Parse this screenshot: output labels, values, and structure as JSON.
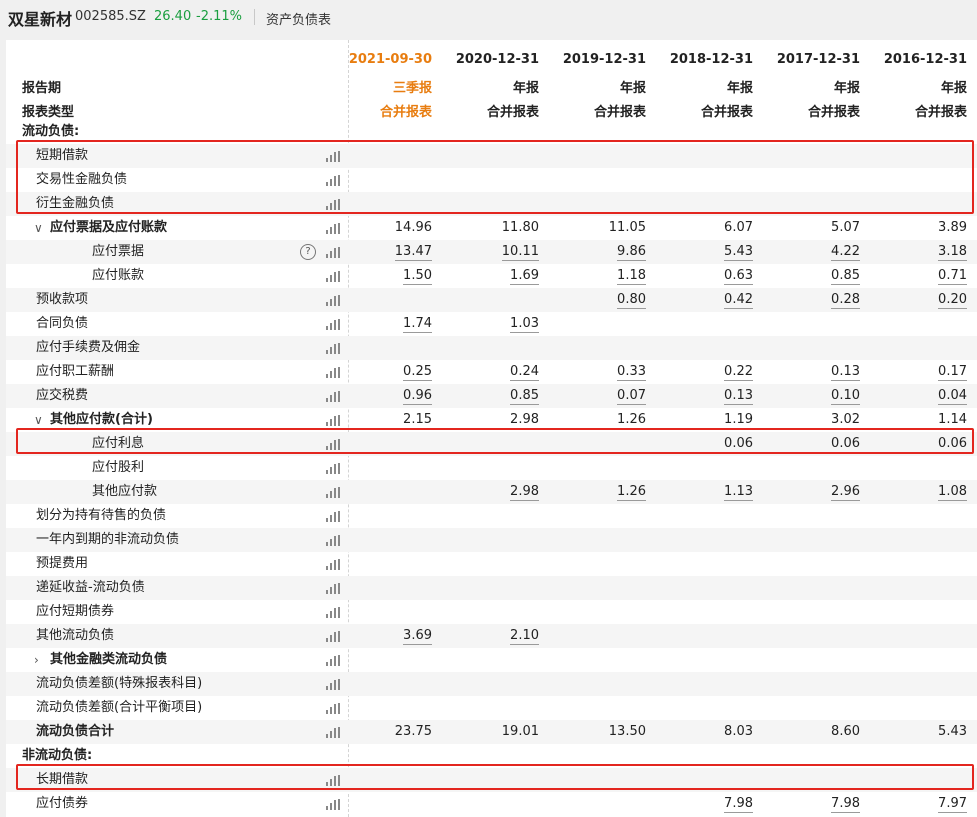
{
  "stock": {
    "name": "双星新材",
    "code": "002585.SZ",
    "price": "26.40",
    "change": "-2.11%",
    "report_title": "资产负债表"
  },
  "colors": {
    "accent": "#e87d10",
    "up_down": "#1a9e3f",
    "highlight": "#e3261f"
  },
  "header": {
    "period_label": "报告期",
    "type_label": "报表类型",
    "columns": [
      {
        "date": "2021-09-30",
        "period": "三季报",
        "type": "合并报表"
      },
      {
        "date": "2020-12-31",
        "period": "年报",
        "type": "合并报表"
      },
      {
        "date": "2019-12-31",
        "period": "年报",
        "type": "合并报表"
      },
      {
        "date": "2018-12-31",
        "period": "年报",
        "type": "合并报表"
      },
      {
        "date": "2017-12-31",
        "period": "年报",
        "type": "合并报表"
      },
      {
        "date": "2016-12-31",
        "period": "年报",
        "type": "合并报表"
      }
    ]
  },
  "rows": [
    {
      "label": "流动负债:",
      "kind": "section",
      "values": [
        "",
        "",
        "",
        "",
        "",
        ""
      ]
    },
    {
      "label": "短期借款",
      "values": [
        "",
        "",
        "",
        "",
        "",
        ""
      ]
    },
    {
      "label": "交易性金融负债",
      "values": [
        "",
        "",
        "",
        "",
        "",
        ""
      ]
    },
    {
      "label": "衍生金融负债",
      "values": [
        "",
        "",
        "",
        "",
        "",
        ""
      ]
    },
    {
      "label": "应付票据及应付账款",
      "kind": "group",
      "values": [
        "14.96",
        "11.80",
        "11.05",
        "6.07",
        "5.07",
        "3.89"
      ]
    },
    {
      "label": "应付票据",
      "kind": "sub",
      "help": "?",
      "values": [
        "13.47",
        "10.11",
        "9.86",
        "5.43",
        "4.22",
        "3.18"
      ]
    },
    {
      "label": "应付账款",
      "kind": "sub",
      "values": [
        "1.50",
        "1.69",
        "1.18",
        "0.63",
        "0.85",
        "0.71"
      ]
    },
    {
      "label": "预收款项",
      "values": [
        "",
        "",
        "0.80",
        "0.42",
        "0.28",
        "0.20"
      ]
    },
    {
      "label": "合同负债",
      "values": [
        "1.74",
        "1.03",
        "",
        "",
        "",
        ""
      ]
    },
    {
      "label": "应付手续费及佣金",
      "values": [
        "",
        "",
        "",
        "",
        "",
        ""
      ]
    },
    {
      "label": "应付职工薪酬",
      "values": [
        "0.25",
        "0.24",
        "0.33",
        "0.22",
        "0.13",
        "0.17"
      ]
    },
    {
      "label": "应交税费",
      "values": [
        "0.96",
        "0.85",
        "0.07",
        "0.13",
        "0.10",
        "0.04"
      ]
    },
    {
      "label": "其他应付款(合计)",
      "kind": "group",
      "values": [
        "2.15",
        "2.98",
        "1.26",
        "1.19",
        "3.02",
        "1.14"
      ]
    },
    {
      "label": "应付利息",
      "kind": "sub",
      "values": [
        "",
        "",
        "",
        "0.06",
        "0.06",
        "0.06"
      ]
    },
    {
      "label": "应付股利",
      "kind": "sub",
      "values": [
        "",
        "",
        "",
        "",
        "",
        ""
      ]
    },
    {
      "label": "其他应付款",
      "kind": "sub",
      "values": [
        "",
        "2.98",
        "1.26",
        "1.13",
        "2.96",
        "1.08"
      ]
    },
    {
      "label": "划分为持有待售的负债",
      "values": [
        "",
        "",
        "",
        "",
        "",
        ""
      ]
    },
    {
      "label": "一年内到期的非流动负债",
      "values": [
        "",
        "",
        "",
        "",
        "",
        ""
      ]
    },
    {
      "label": "预提费用",
      "values": [
        "",
        "",
        "",
        "",
        "",
        ""
      ]
    },
    {
      "label": "递延收益-流动负债",
      "values": [
        "",
        "",
        "",
        "",
        "",
        ""
      ]
    },
    {
      "label": "应付短期债券",
      "values": [
        "",
        "",
        "",
        "",
        "",
        ""
      ]
    },
    {
      "label": "其他流动负债",
      "values": [
        "3.69",
        "2.10",
        "",
        "",
        "",
        ""
      ]
    },
    {
      "label": "其他金融类流动负债",
      "kind": "collapsed",
      "values": [
        "",
        "",
        "",
        "",
        "",
        ""
      ]
    },
    {
      "label": "流动负债差额(特殊报表科目)",
      "values": [
        "",
        "",
        "",
        "",
        "",
        ""
      ]
    },
    {
      "label": "流动负债差额(合计平衡项目)",
      "values": [
        "",
        "",
        "",
        "",
        "",
        ""
      ]
    },
    {
      "label": "流动负债合计",
      "kind": "total",
      "values": [
        "23.75",
        "19.01",
        "13.50",
        "8.03",
        "8.60",
        "5.43"
      ]
    },
    {
      "label": "非流动负债:",
      "kind": "section",
      "values": [
        "",
        "",
        "",
        "",
        "",
        ""
      ]
    },
    {
      "label": "长期借款",
      "values": [
        "",
        "",
        "",
        "",
        "",
        ""
      ]
    },
    {
      "label": "应付债券",
      "values": [
        "",
        "",
        "",
        "7.98",
        "7.98",
        "7.97"
      ]
    }
  ]
}
